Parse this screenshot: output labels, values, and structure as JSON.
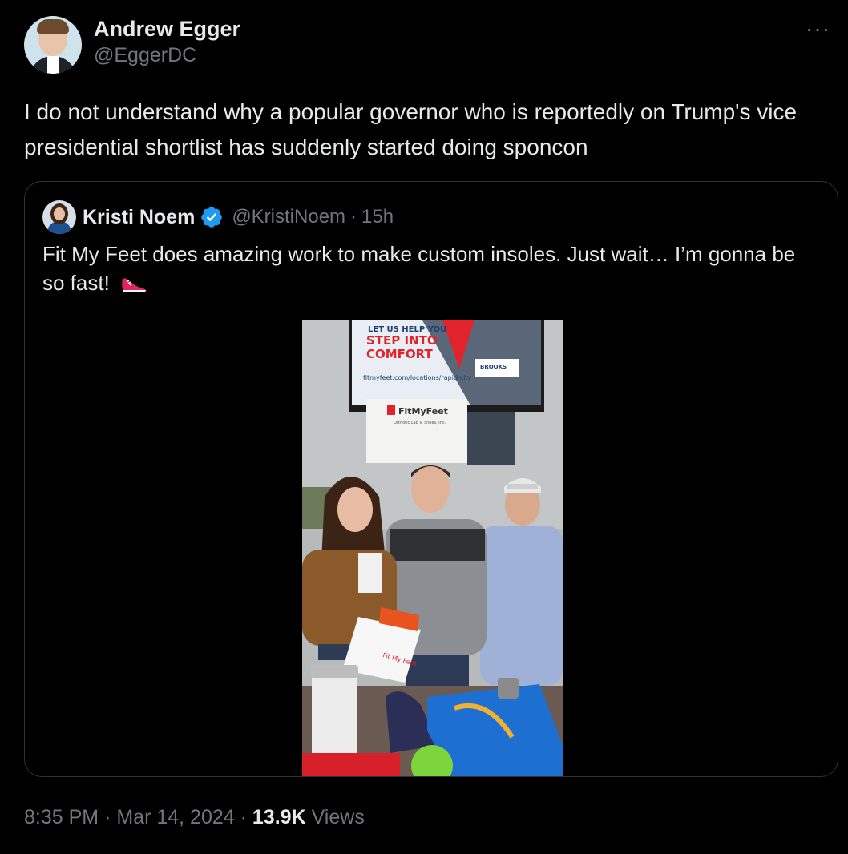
{
  "author": {
    "name": "Andrew Egger",
    "handle": "@EggerDC"
  },
  "more_icon": "more-horizontal-icon",
  "tweet": {
    "text": "I do not understand why a popular governor who is reportedly on Trump's vice presidential shortlist has suddenly started doing sponcon"
  },
  "quote": {
    "name": "Kristi Noem",
    "verified_icon": "verified-badge-icon",
    "handle": "@KristiNoem",
    "separator": "·",
    "time": "15h",
    "text": "Fit My Feet does amazing work to make custom insoles. Just wait… I’m gonna be so fast!",
    "emoji": "running-shoe-icon",
    "media": {
      "tv_line1": "LET US HELP YOU",
      "tv_line2": "STEP INTO",
      "tv_line3": "COMFORT",
      "tv_url": "fitmyfeet.com/locations/rapid-city",
      "tv_brand": "BROOKS",
      "sign_brand": "FitMyFeet",
      "sign_sub": "Orthotic Lab & Shoes, Inc.",
      "bag_text": "Fit My Feet"
    }
  },
  "footer": {
    "time": "8:35 PM",
    "sep1": "·",
    "date": "Mar 14, 2024",
    "sep2": "·",
    "views_count": "13.9K",
    "views_label": "Views"
  },
  "colors": {
    "background": "#000000",
    "primary_text": "#e7e9ea",
    "secondary_text": "#71767b",
    "border": "#2f3336",
    "verified": "#1d9bf0"
  }
}
